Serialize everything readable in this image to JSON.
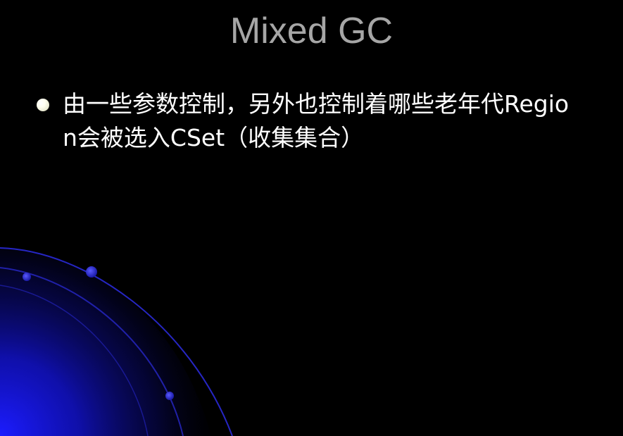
{
  "slide": {
    "title": "Mixed GC",
    "bullets": [
      {
        "text": "由一些参数控制，另外也控制着哪些老年代Region会被选入CSet（收集集合）"
      }
    ]
  },
  "colors": {
    "background": "#000000",
    "title": "#a6a6a6",
    "body_text": "#ffffff",
    "bullet": "#fffff0",
    "decoration_blue": "#1a1aff"
  },
  "icons": {
    "bullet": "bullet-dot-icon",
    "decoration": "blue-arc-orbit-icon"
  }
}
